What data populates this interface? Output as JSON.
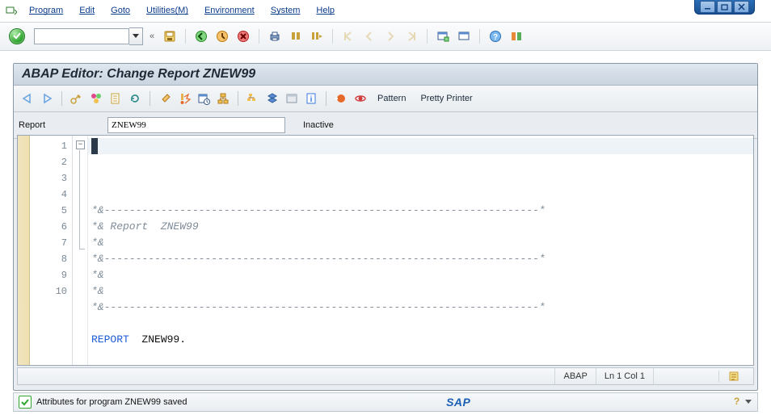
{
  "window": {
    "min": "min",
    "max": "max",
    "close": "close"
  },
  "menubar": {
    "items": [
      {
        "label": "Program",
        "mnem": "P"
      },
      {
        "label": "Edit",
        "mnem": "E"
      },
      {
        "label": "Goto",
        "mnem": "G"
      },
      {
        "label": "Utilities(M)",
        "mnem": "M"
      },
      {
        "label": "Environment",
        "mnem": "E"
      },
      {
        "label": "System",
        "mnem": "S"
      },
      {
        "label": "Help",
        "mnem": "H"
      }
    ]
  },
  "toolbar": {
    "command": "",
    "icons": [
      "save",
      "back",
      "exit",
      "cancel",
      "print",
      "find",
      "find-next",
      "first",
      "prev",
      "next",
      "last",
      "new-session",
      "layout",
      "help",
      "techinfo"
    ]
  },
  "panel": {
    "title": "ABAP Editor: Change Report ZNEW99"
  },
  "apptoolbar": {
    "pattern": "Pattern",
    "pretty": "Pretty Printer"
  },
  "report": {
    "label": "Report",
    "value": "ZNEW99",
    "status": "Inactive"
  },
  "editor": {
    "lines_count": 10,
    "lines": [
      "*&---------------------------------------------------------------------*",
      "*& Report  ZNEW99",
      "*&",
      "*&---------------------------------------------------------------------*",
      "*&",
      "*&",
      "*&---------------------------------------------------------------------*",
      "",
      "REPORT  ZNEW99.",
      ""
    ]
  },
  "editfoot": {
    "lang": "ABAP",
    "pos": "Ln  1 Col  1"
  },
  "statusbar": {
    "msg": "Attributes for program ZNEW99 saved",
    "logo": "SAP"
  }
}
